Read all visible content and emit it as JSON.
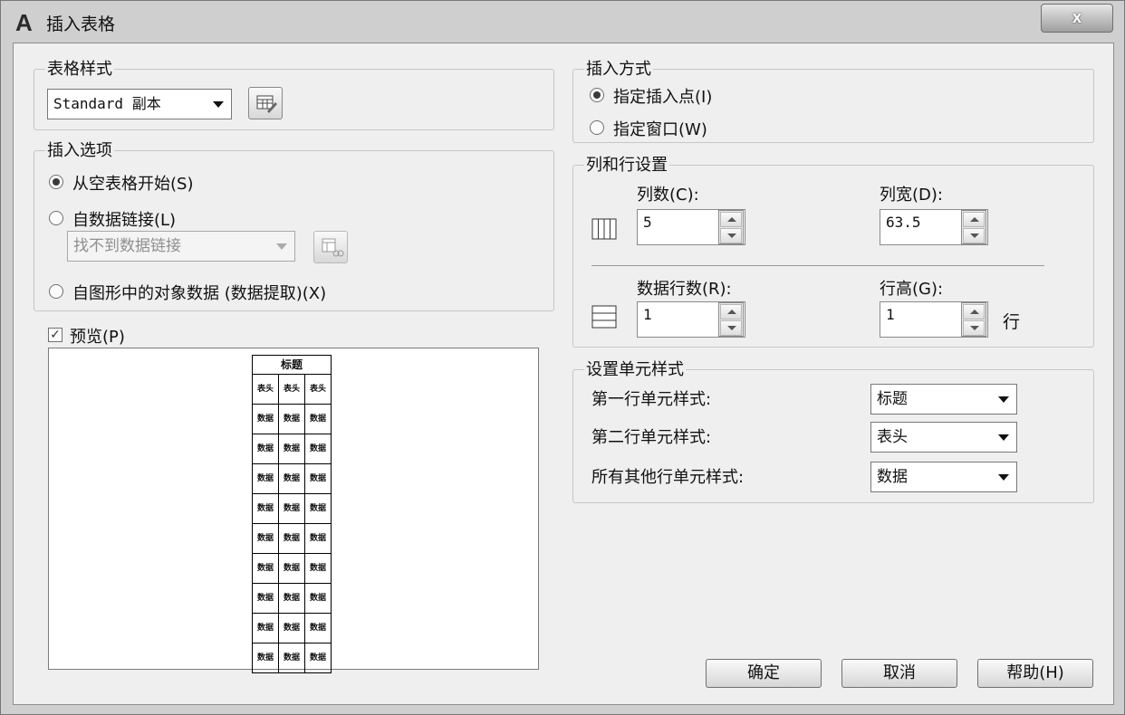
{
  "window": {
    "title": "插入表格",
    "close_label": "x"
  },
  "table_style": {
    "group_label": "表格样式",
    "selected": "Standard 副本",
    "edit_icon": "table-style-edit-icon"
  },
  "insert_options": {
    "group_label": "插入选项",
    "option_empty": "从空表格开始(S)",
    "option_datalink": "自数据链接(L)",
    "datalink_combo": "找不到数据链接",
    "datalink_icon": "datalink-manager-icon",
    "option_extract": "自图形中的对象数据 (数据提取)(X)"
  },
  "preview": {
    "label": "预览(P)",
    "checked": true,
    "table_title": "标题",
    "header_cell": "表头",
    "data_cell": "数据"
  },
  "insert_method": {
    "group_label": "插入方式",
    "option_point": "指定插入点(I)",
    "option_window": "指定窗口(W)"
  },
  "col_row": {
    "group_label": "列和行设置",
    "columns_label": "列数(C):",
    "columns_value": "5",
    "col_width_label": "列宽(D):",
    "col_width_value": "63.5",
    "data_rows_label": "数据行数(R):",
    "data_rows_value": "1",
    "row_height_label": "行高(G):",
    "row_height_value": "1",
    "row_unit": "行",
    "columns_icon": "columns-icon",
    "rows_icon": "rows-icon"
  },
  "cell_styles": {
    "group_label": "设置单元样式",
    "first_row_label": "第一行单元样式:",
    "first_row_value": "标题",
    "second_row_label": "第二行单元样式:",
    "second_row_value": "表头",
    "other_rows_label": "所有其他行单元样式:",
    "other_rows_value": "数据"
  },
  "buttons": {
    "ok": "确定",
    "cancel": "取消",
    "help": "帮助(H)"
  }
}
